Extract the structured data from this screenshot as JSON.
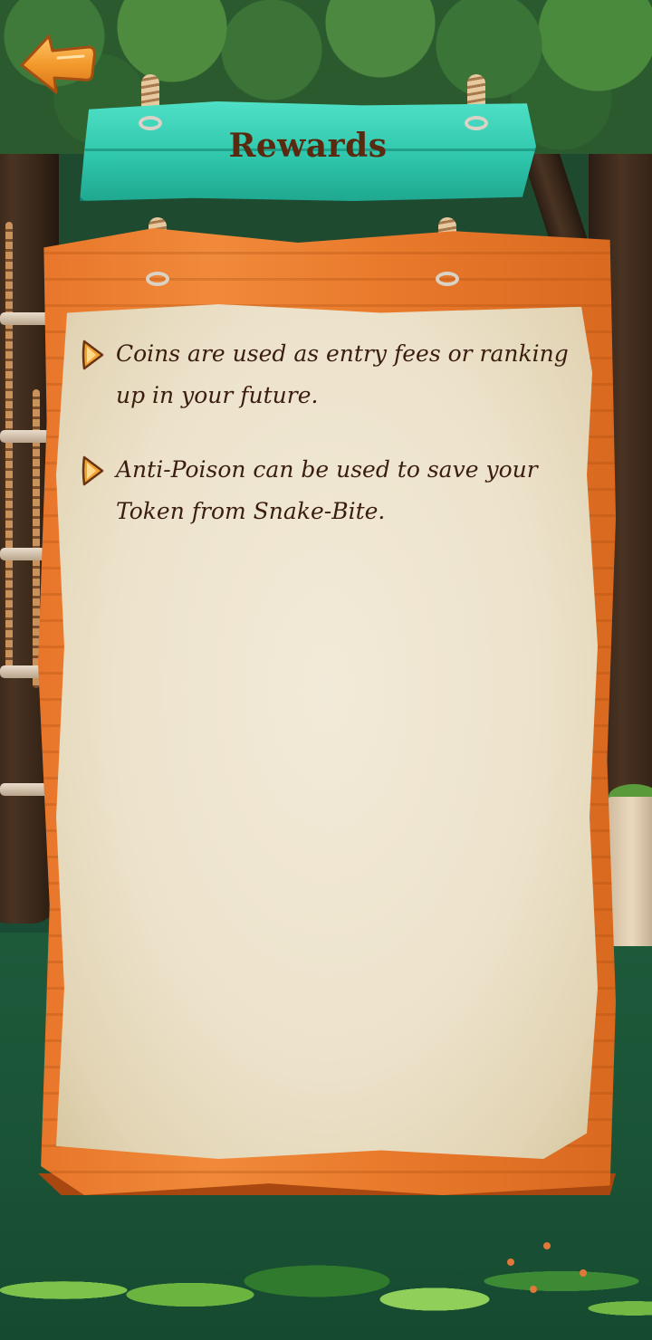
{
  "screen": {
    "title": "Rewards"
  },
  "navigation": {
    "back_icon": "back-arrow-icon"
  },
  "rules": [
    {
      "icon": "arrow-bullet-icon",
      "text": "Coins are used as entry fees or ranking up in your future."
    },
    {
      "icon": "arrow-bullet-icon",
      "text": "Anti-Poison can be used to save your Token from Snake-Bite."
    }
  ],
  "colors": {
    "sign_teal": "#2fc7ad",
    "board_orange": "#e8762a",
    "parchment": "#ede3cc",
    "title_text": "#5a2a10",
    "body_text": "#3a1d0e"
  }
}
